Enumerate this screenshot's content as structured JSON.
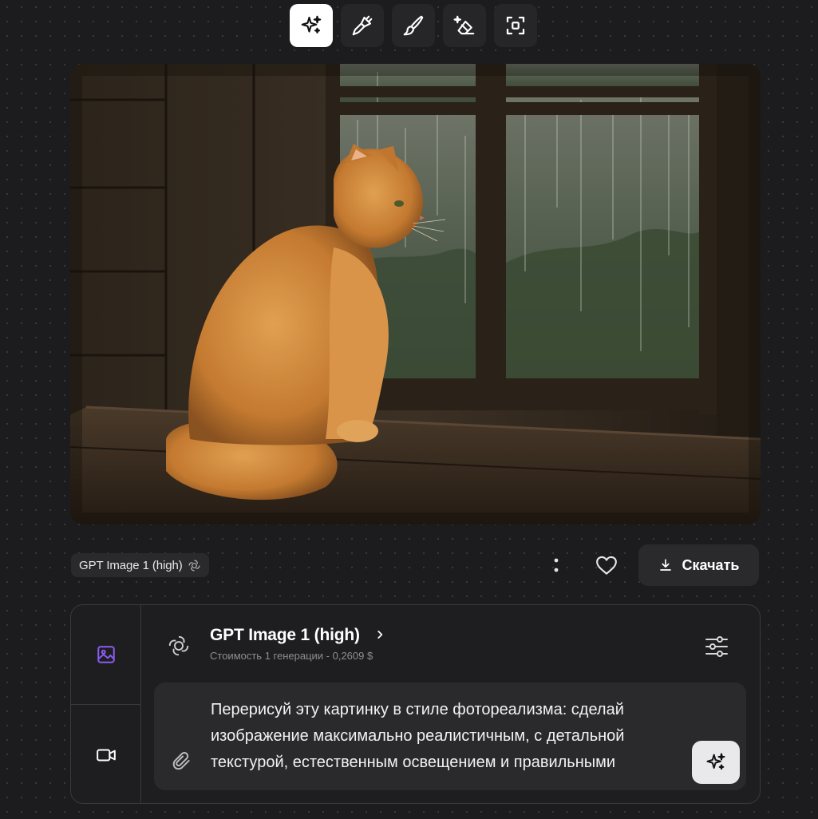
{
  "toolbar": {
    "tools": [
      {
        "icon": "sparkle-icon",
        "active": true
      },
      {
        "icon": "paint-brush-icon",
        "active": false
      },
      {
        "icon": "pen-brush-icon",
        "active": false
      },
      {
        "icon": "eraser-sparkle-icon",
        "active": false
      },
      {
        "icon": "crop-frame-icon",
        "active": false
      }
    ]
  },
  "result": {
    "image_icon": "generated-image",
    "model_chip_label": "GPT Image 1 (high)",
    "download_label": "Скачать"
  },
  "panel": {
    "model_name": "GPT Image 1 (high)",
    "cost_label": "Стоимость 1 генерации - 0,2609 $",
    "prompt": "Перерисуй эту картинку в стиле фотореализма: сделай изображение максимально реалистичным, с детальной текстурой, естественным освещением и правильными"
  },
  "colors": {
    "background": "#1c1c1e",
    "accent_purple": "#8b5cf6",
    "surface": "#2a2a2c"
  }
}
